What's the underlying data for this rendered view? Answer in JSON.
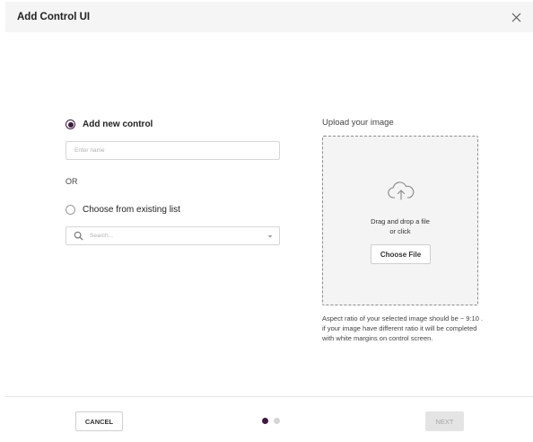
{
  "dialog": {
    "title": "Add Control UI",
    "close_icon": "close-icon"
  },
  "left_panel": {
    "option_new": {
      "label": "Add new control",
      "selected": true
    },
    "name_input": {
      "value": "",
      "placeholder": "Enter name"
    },
    "or_text": "OR",
    "option_existing": {
      "label": "Choose from existing list",
      "selected": false
    },
    "search": {
      "value": "",
      "placeholder": "Search...",
      "icon": "search-icon",
      "dropdown_icon": "chevron-down-icon"
    }
  },
  "right_panel": {
    "upload_title": "Upload your image",
    "dropzone": {
      "icon": "cloud-upload-icon",
      "line1": "Drag and drop a file",
      "line2": "or click",
      "button_label": "Choose File"
    },
    "aspect_note": "Aspect ratio of your selected image should be ~ 9:10 . if your image have different ratio it will be completed with white margins on control screen."
  },
  "footer": {
    "cancel_label": "CANCEL",
    "next_label": "NEXT",
    "steps_total": 2,
    "current_step": 1
  },
  "colors": {
    "accent": "#3d1a3f",
    "header_bg": "#f5f5f5",
    "dropzone_bg": "#f4f4f4",
    "disabled_bg": "#e4e4e4"
  }
}
